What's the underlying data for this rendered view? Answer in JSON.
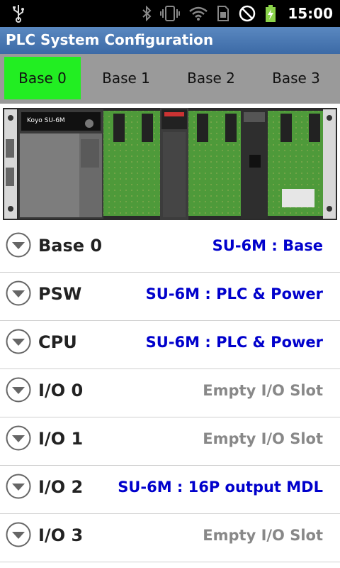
{
  "status_bar": {
    "time": "15:00",
    "icons": [
      "usb-icon",
      "bluetooth-icon",
      "vibrate-icon",
      "wifi-icon",
      "sim-icon",
      "no-signal-icon",
      "battery-charging-icon"
    ]
  },
  "app": {
    "title": "PLC System Configuration"
  },
  "tabs": [
    {
      "label": "Base 0",
      "active": true
    },
    {
      "label": "Base 1",
      "active": false
    },
    {
      "label": "Base 2",
      "active": false
    },
    {
      "label": "Base 3",
      "active": false
    }
  ],
  "rack_image": {
    "brand_text": "Koyo SU-6M"
  },
  "slots": [
    {
      "label": "Base 0",
      "value": "SU-6M : Base",
      "empty": false
    },
    {
      "label": "PSW",
      "value": "SU-6M : PLC & Power",
      "empty": false
    },
    {
      "label": "CPU",
      "value": "SU-6M : PLC & Power",
      "empty": false
    },
    {
      "label": "I/O 0",
      "value": "Empty I/O Slot",
      "empty": true
    },
    {
      "label": "I/O 1",
      "value": "Empty I/O Slot",
      "empty": true
    },
    {
      "label": "I/O 2",
      "value": "SU-6M : 16P output MDL",
      "empty": false
    },
    {
      "label": "I/O 3",
      "value": "Empty I/O Slot",
      "empty": true
    }
  ],
  "colors": {
    "tab_active": "#22ee22",
    "value_filled": "#0000cc",
    "value_empty": "#888888",
    "titlebar": "#4a78b4"
  }
}
